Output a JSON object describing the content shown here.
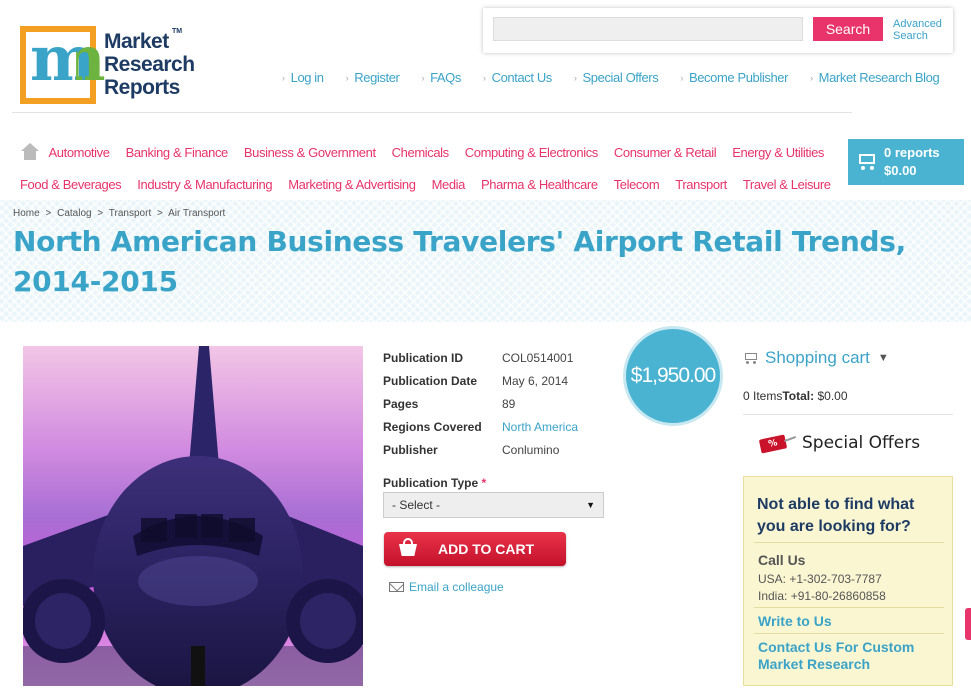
{
  "logo": {
    "line1": "Market",
    "line2": "Research",
    "line3": "Reports",
    "tm": "TM",
    "letter": "m"
  },
  "search": {
    "placeholder": "",
    "button": "Search",
    "advanced_line1": "Advanced",
    "advanced_line2": "Search"
  },
  "toplinks": [
    "Log in",
    "Register",
    "FAQs",
    "Contact Us",
    "Special Offers",
    "Become Publisher",
    "Market Research Blog"
  ],
  "categories": {
    "row1": [
      "Automotive",
      "Banking & Finance",
      "Business & Government",
      "Chemicals",
      "Computing & Electronics",
      "Consumer & Retail",
      "Energy & Utilities"
    ],
    "row2": [
      "Food & Beverages",
      "Industry & Manufacturing",
      "Marketing & Advertising",
      "Media",
      "Pharma & Healthcare",
      "Telecom",
      "Transport",
      "Travel & Leisure"
    ]
  },
  "cart": {
    "count": "0 reports",
    "total": "$0.00"
  },
  "breadcrumb": [
    "Home",
    ">",
    "Catalog",
    ">",
    "Transport",
    ">",
    "Air Transport"
  ],
  "title": "North American Business Travelers' Airport Retail Trends, 2014-2015",
  "specs": [
    {
      "key": "Publication ID",
      "value": "COL0514001"
    },
    {
      "key": "Publication Date",
      "value": "May 6, 2014"
    },
    {
      "key": "Pages",
      "value": "89"
    },
    {
      "key": "Regions Covered",
      "value": "North America"
    },
    {
      "key": "Publisher",
      "value": "Conlumino"
    }
  ],
  "publication_type": {
    "label": "Publication Type",
    "required": "*",
    "selected": "- Select -"
  },
  "add_to_cart": "ADD TO CART",
  "email_colleague": "Email a colleague",
  "price": "$1,950.00",
  "shopping_cart": {
    "heading": "Shopping cart",
    "items": "0 Items",
    "total_label": "Total:",
    "total_value": " $0.00"
  },
  "special_offers": "Special Offers",
  "offer_tag": "%",
  "help": {
    "title": "Not able to find what you are looking for?",
    "call_us": "Call Us",
    "usa": "USA: +1-302-703-7787",
    "india": "India: +91-80-26860858",
    "write_us": "Write to Us",
    "contact_custom": "Contact Us For Custom Market Research"
  },
  "colors": {
    "accent_blue": "#3aa3c8",
    "accent_pink": "#e8336b",
    "cart_blue": "#4ab3d2",
    "add_cart_red": "#c4112a",
    "navy": "#1e3b64"
  }
}
